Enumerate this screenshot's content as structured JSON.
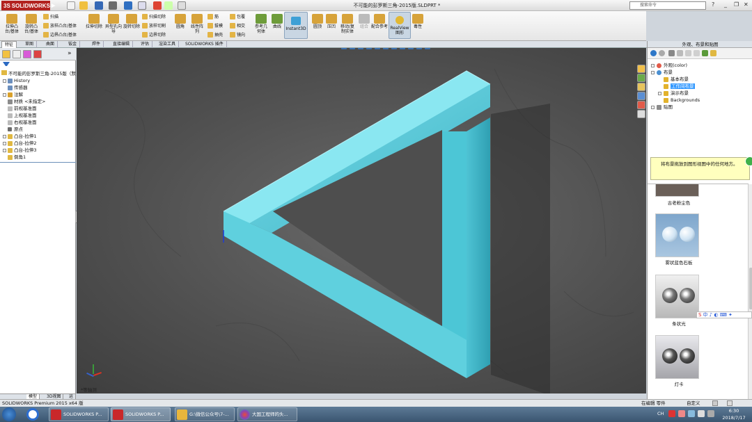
{
  "app": {
    "brand": "SOLIDWORKS",
    "document_title": "不可能的彭罗斯三角-2015版.SLDPRT *",
    "search_placeholder": "搜索命令"
  },
  "ribbon": {
    "big_buttons": [
      {
        "label": "拉伸凸台/基体",
        "color": "#d7a33a"
      },
      {
        "label": "旋转凸台/基体",
        "color": "#d7a33a"
      },
      {
        "label": "拉伸切除",
        "color": "#d7a33a"
      },
      {
        "label": "异型孔向导",
        "color": "#d7a33a"
      },
      {
        "label": "旋转切除",
        "color": "#d7a33a"
      },
      {
        "label": "圆角",
        "color": "#d7a33a"
      },
      {
        "label": "线性阵列",
        "color": "#d7a33a"
      },
      {
        "label": "参考几何体",
        "color": "#6e9c3a"
      },
      {
        "label": "曲线",
        "color": "#6e9c3a"
      },
      {
        "label": "Instant3D",
        "color": "#3ea0d6"
      },
      {
        "label": "圆顶",
        "color": "#d7a33a"
      },
      {
        "label": "压凹",
        "color": "#d7a33a"
      },
      {
        "label": "移动/复制实体",
        "color": "#d7a33a"
      },
      {
        "label": "组合",
        "color": "#bbbbbb"
      },
      {
        "label": "配合参考",
        "color": "#d7a33a"
      },
      {
        "label": "RealView图形",
        "color": "#e2b833"
      },
      {
        "label": "毒性",
        "color": "#d7a33a"
      }
    ],
    "small_buttons": [
      "扫描",
      "放样凸台/基体",
      "边界凸台/基体",
      "扫描切除",
      "放样切割",
      "边界切除",
      "筋",
      "拔模",
      "抽壳",
      "包覆",
      "相交",
      "镜向"
    ]
  },
  "tabs": [
    {
      "label": "特征",
      "active": true
    },
    {
      "label": "草图"
    },
    {
      "label": "曲面"
    },
    {
      "label": "钣金"
    },
    {
      "label": "焊件"
    },
    {
      "label": "直接编辑"
    },
    {
      "label": "评估"
    },
    {
      "label": "渲染工具"
    },
    {
      "label": "SOLIDWORKS 插件"
    }
  ],
  "feature_tree": {
    "root": "不可能的彭罗斯三角-2015版（默",
    "items": [
      {
        "label": "History",
        "icon_color": "#6c8fbd",
        "expand": true
      },
      {
        "label": "传感器",
        "icon_color": "#6c8fbd",
        "expand": false
      },
      {
        "label": "注解",
        "icon_color": "#d9a12c",
        "expand": true
      },
      {
        "label": "材质 <未指定>",
        "icon_color": "#8c8c8c",
        "expand": false
      },
      {
        "label": "前视基准面",
        "icon_color": "#8c8c8c",
        "expand": false
      },
      {
        "label": "上视基准面",
        "icon_color": "#8c8c8c",
        "expand": false
      },
      {
        "label": "右视基准面",
        "icon_color": "#8c8c8c",
        "expand": false
      },
      {
        "label": "原点",
        "icon_color": "#6b6b6b",
        "expand": false
      },
      {
        "label": "凸台-拉伸1",
        "icon_color": "#e0b842",
        "expand": true
      },
      {
        "label": "凸台-拉伸2",
        "icon_color": "#e0b842",
        "expand": true
      },
      {
        "label": "凸台-拉伸3",
        "icon_color": "#e0b842",
        "expand": true
      },
      {
        "label": "倒角1",
        "icon_color": "#e0b842",
        "expand": false
      }
    ]
  },
  "bottom_tabs": [
    "模型",
    "3D视图",
    "运动算例1"
  ],
  "triad_label": "*等轴测",
  "status": {
    "left": "SOLIDWORKS Premium 2015 x64 版",
    "mode": "在编辑 零件",
    "custom": "自定义"
  },
  "right_panel": {
    "title": "外观、布景和贴图",
    "tree": [
      {
        "label": "外观(color)",
        "level": 0,
        "icon_color": "#e25b4a",
        "expand": true
      },
      {
        "label": "布景",
        "level": 0,
        "icon_color": "#4a8fd1",
        "expand": true
      },
      {
        "label": "基本布景",
        "level": 1,
        "icon_color": "#e2b22c"
      },
      {
        "label": "工作间布景",
        "level": 1,
        "icon_color": "#e2b22c",
        "selected": true
      },
      {
        "label": "演示布景",
        "level": 1,
        "icon_color": "#e2b22c",
        "expand": true
      },
      {
        "label": "Backgrounds",
        "level": 1,
        "icon_color": "#e2b22c"
      },
      {
        "label": "贴图",
        "level": 0,
        "icon_color": "#8c8c8c",
        "expand": true
      }
    ],
    "hint": "将布景拖放到图形视图中的任何地方。",
    "gallery": [
      {
        "caption": "古老粉尘色",
        "bg": "#6a5f58",
        "ball": "#a49a92"
      },
      {
        "caption": "雾状蓝色石板",
        "bg": "#7ea6cc",
        "ball": "#cfe3f3"
      },
      {
        "caption": "条状光",
        "bg": "#d9d9d9",
        "ball": "#3a3a3a"
      },
      {
        "caption": "灯卡",
        "bg": "#c8c8cc",
        "ball": "#262626"
      }
    ]
  },
  "taskbar": {
    "buttons": [
      {
        "label": "SOLIDWORKS P...",
        "color": "#c9282a"
      },
      {
        "label": "SOLIDWORKS P...",
        "color": "#c9282a"
      },
      {
        "label": "G:\\微信公众号\\7-...",
        "color": "#e8b63c"
      },
      {
        "label": "大国工程师的头...",
        "color": "#d64ad8"
      }
    ],
    "clock": "6:30",
    "date": "2018/7/17"
  },
  "colors": {
    "model": "#4fc6d8",
    "model_dark": "#2ba3b6",
    "model_light": "#86e3ee",
    "background": "#565656"
  }
}
